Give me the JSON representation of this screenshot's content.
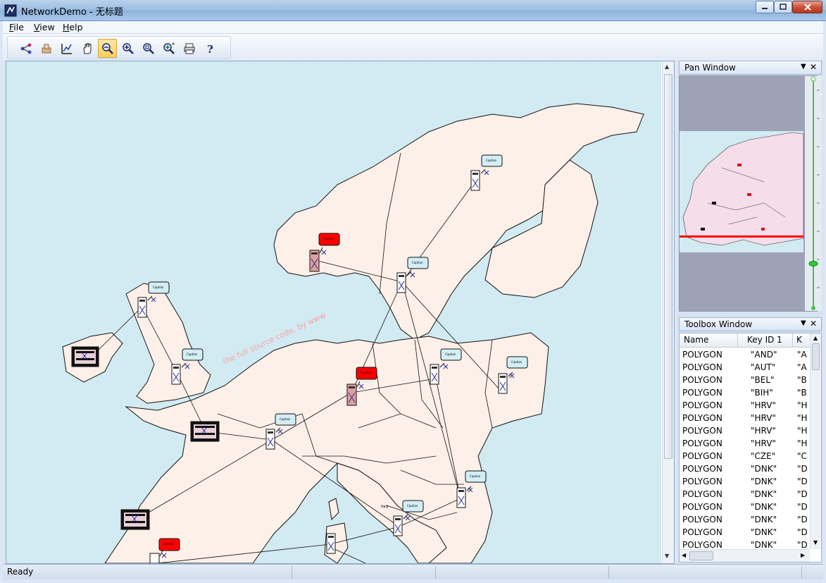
{
  "window": {
    "title": "NetworkDemo - 无标题",
    "controls": {
      "minimize": "minimize-icon",
      "maximize": "maximize-icon",
      "close": "close-icon"
    }
  },
  "menu": {
    "items": [
      {
        "label": "File",
        "mnemonic": "F"
      },
      {
        "label": "View",
        "mnemonic": "V"
      },
      {
        "label": "Help",
        "mnemonic": "H"
      }
    ]
  },
  "toolbar": {
    "buttons": [
      {
        "name": "network-tool-icon",
        "active": false
      },
      {
        "name": "layer-tool-icon",
        "active": false
      },
      {
        "name": "chart-tool-icon",
        "active": false
      },
      {
        "name": "pan-hand-icon",
        "active": false
      },
      {
        "name": "zoom-out-icon",
        "active": true
      },
      {
        "name": "zoom-in-icon",
        "active": false
      },
      {
        "name": "zoom-fit-icon",
        "active": false
      },
      {
        "name": "zoom-plus-icon",
        "active": false
      },
      {
        "name": "print-icon",
        "active": false
      },
      {
        "name": "help-icon",
        "active": false
      }
    ]
  },
  "map": {
    "sea_color": "#d2eaf2",
    "land_color": "#fdf0e9",
    "node_caption": "Caption",
    "highlight_color": "#ff0000",
    "city_label": "Italy",
    "watermark": "the full source code, by www"
  },
  "pan_window": {
    "title": "Pan Window"
  },
  "toolbox_window": {
    "title": "Toolbox Window",
    "columns": [
      "Name",
      "Key ID 1",
      "K"
    ],
    "rows": [
      [
        "POLYGON",
        "\"AND\"",
        "\"A"
      ],
      [
        "POLYGON",
        "\"AUT\"",
        "\"A"
      ],
      [
        "POLYGON",
        "\"BEL\"",
        "\"B"
      ],
      [
        "POLYGON",
        "\"BIH\"",
        "\"B"
      ],
      [
        "POLYGON",
        "\"HRV\"",
        "\"H"
      ],
      [
        "POLYGON",
        "\"HRV\"",
        "\"H"
      ],
      [
        "POLYGON",
        "\"HRV\"",
        "\"H"
      ],
      [
        "POLYGON",
        "\"HRV\"",
        "\"H"
      ],
      [
        "POLYGON",
        "\"CZE\"",
        "\"C"
      ],
      [
        "POLYGON",
        "\"DNK\"",
        "\"D"
      ],
      [
        "POLYGON",
        "\"DNK\"",
        "\"D"
      ],
      [
        "POLYGON",
        "\"DNK\"",
        "\"D"
      ],
      [
        "POLYGON",
        "\"DNK\"",
        "\"D"
      ],
      [
        "POLYGON",
        "\"DNK\"",
        "\"D"
      ],
      [
        "POLYGON",
        "\"DNK\"",
        "\"D"
      ],
      [
        "POLYGON",
        "\"DNK\"",
        "\"D"
      ]
    ]
  },
  "status": {
    "text": "Ready"
  }
}
